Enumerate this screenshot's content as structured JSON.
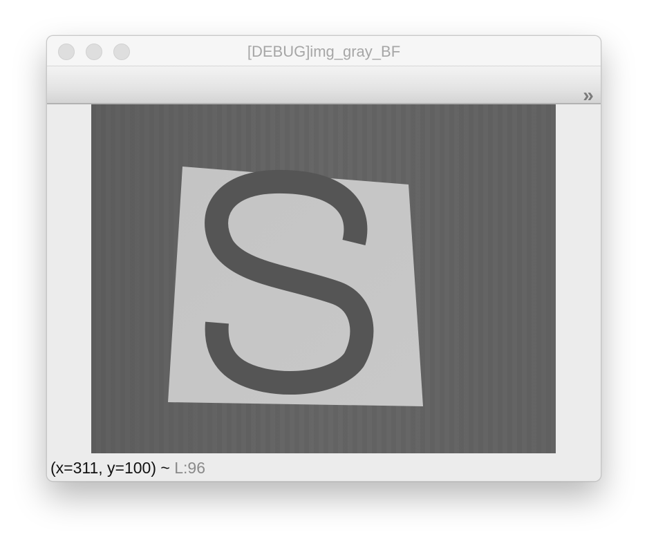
{
  "window": {
    "title": "[DEBUG]img_gray_BF"
  },
  "toolbar": {
    "overflow_icon": "chevrons-right-icon",
    "overflow_glyph": "»"
  },
  "image": {
    "description_icon": "grayscale-image",
    "letter": "S"
  },
  "status": {
    "coords": "(x=311, y=100) ~",
    "luma": "L:96"
  }
}
